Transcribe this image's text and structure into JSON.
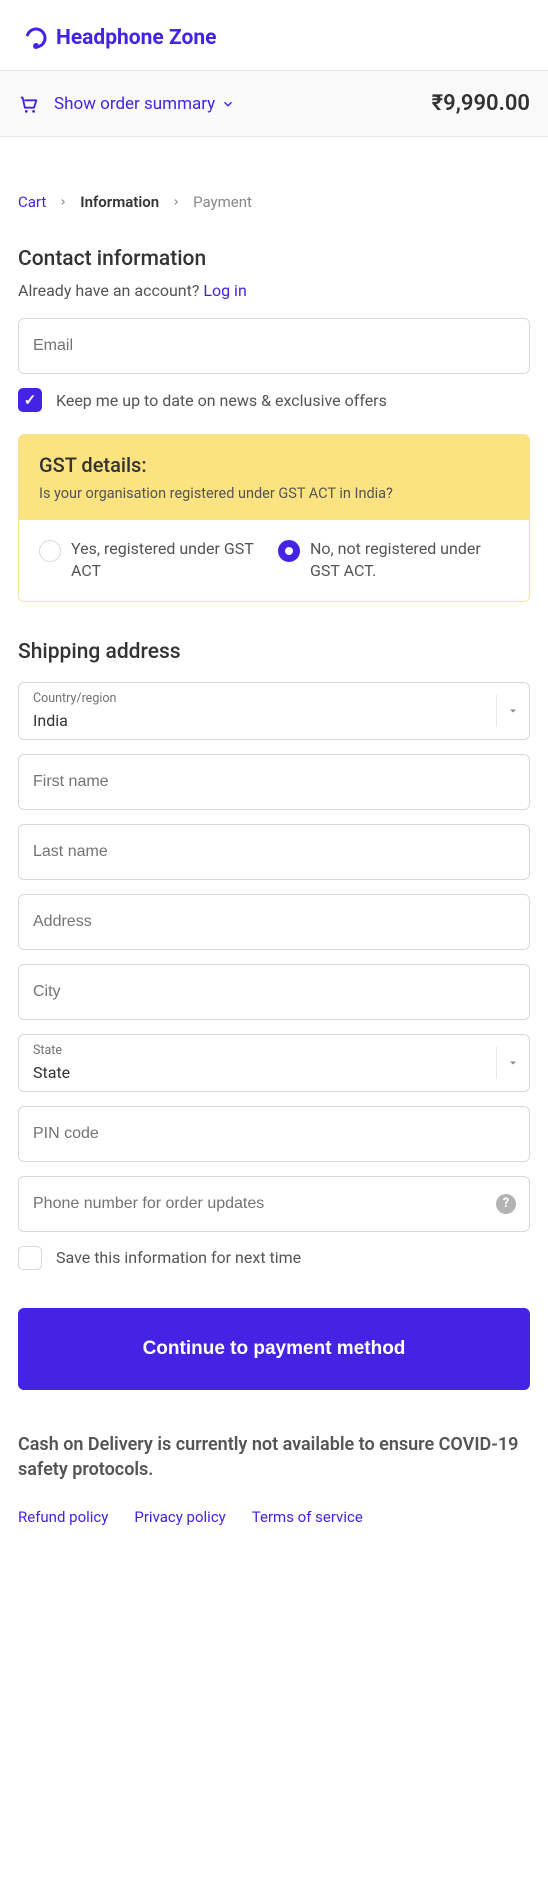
{
  "brand": "Headphone Zone",
  "summary": {
    "toggle_label": "Show order summary",
    "total": "₹9,990.00"
  },
  "breadcrumb": {
    "cart": "Cart",
    "information": "Information",
    "payment": "Payment"
  },
  "contact": {
    "title": "Contact information",
    "have_account": "Already have an account?",
    "login": "Log in",
    "email_placeholder": "Email",
    "opt_in": "Keep me up to date on news & exclusive offers"
  },
  "gst": {
    "title": "GST details:",
    "subtitle": "Is your organisation registered under GST ACT in India?",
    "opt_yes": "Yes, registered under GST ACT",
    "opt_no": "No, not registered under GST ACT."
  },
  "shipping": {
    "title": "Shipping address",
    "country_label": "Country/region",
    "country_value": "India",
    "first_name": "First name",
    "last_name": "Last name",
    "address": "Address",
    "city": "City",
    "state_label": "State",
    "state_value": "State",
    "pin": "PIN code",
    "phone": "Phone number for order updates",
    "save_info": "Save this information for next time"
  },
  "actions": {
    "continue": "Continue to payment method"
  },
  "notice": "Cash on Delivery is currently not available to ensure COVID-19 safety protocols.",
  "footer": {
    "refund": "Refund policy",
    "privacy": "Privacy policy",
    "terms": "Terms of service"
  }
}
